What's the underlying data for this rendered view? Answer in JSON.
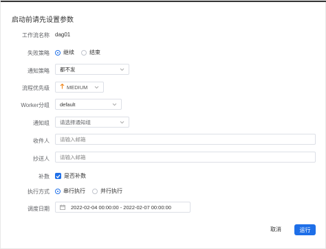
{
  "dialog": {
    "title": "启动前请先设置参数"
  },
  "form": {
    "workflow_name": {
      "label": "工作流名称",
      "value": "dag01"
    },
    "failure_strategy": {
      "label": "失败策略",
      "options": [
        "继续",
        "结束"
      ],
      "selected": "继续"
    },
    "notify_strategy": {
      "label": "通知策略",
      "value": "都不发"
    },
    "priority": {
      "label": "流程优先级",
      "value": "MEDIUM",
      "icon": "arrow-up-icon",
      "color": "#f08a24"
    },
    "worker_group": {
      "label": "Worker分组",
      "value": "default"
    },
    "notify_group": {
      "label": "通知组",
      "placeholder": "请选择通知组"
    },
    "recipients": {
      "label": "收件人",
      "placeholder": "请输入邮箱"
    },
    "cc": {
      "label": "抄送人",
      "placeholder": "请输入邮箱"
    },
    "backfill": {
      "label": "补数",
      "checkbox_label": "是否补数",
      "checked": true
    },
    "exec_mode": {
      "label": "执行方式",
      "options": [
        "串行执行",
        "并行执行"
      ],
      "selected": "串行执行"
    },
    "schedule_date": {
      "label": "调度日期",
      "value": "2022-02-04 00:00:00 - 2022-02-07 00:00:00"
    }
  },
  "footer": {
    "cancel_label": "取消",
    "run_label": "运行"
  },
  "colors": {
    "primary": "#1e6fe8",
    "border": "#dcdfe6"
  }
}
